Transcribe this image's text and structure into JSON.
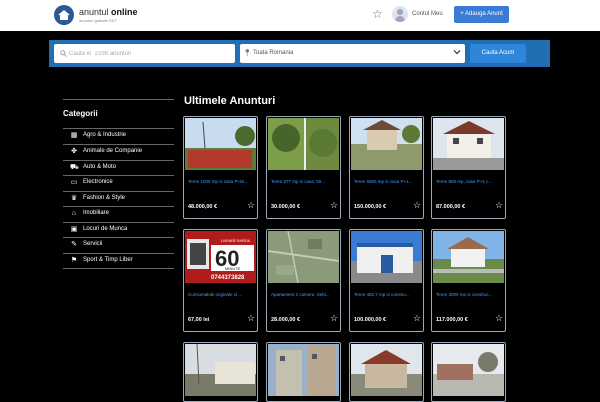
{
  "header": {
    "logo_main": "anuntul",
    "logo_bold": "online",
    "logo_sub": "anunturi gratuite 24/7",
    "account_label": "Contul Meu",
    "add_button": "+ Adauga Anunt"
  },
  "search": {
    "placeholder": "Cauta in  2298 anunturi",
    "location": "Toata Romania",
    "button": "Cauta Acum"
  },
  "sidebar": {
    "title": "Categorii",
    "items": [
      {
        "label": "Agro & Industrie",
        "icon": "grid-icon"
      },
      {
        "label": "Animale de Companie",
        "icon": "paw-icon"
      },
      {
        "label": "Auto & Moto",
        "icon": "car-icon"
      },
      {
        "label": "Electronice",
        "icon": "tv-icon"
      },
      {
        "label": "Fashion & Style",
        "icon": "shirt-icon"
      },
      {
        "label": "Imobiliare",
        "icon": "home-icon"
      },
      {
        "label": "Locuri de Munca",
        "icon": "briefcase-icon"
      },
      {
        "label": "Servicii",
        "icon": "wrench-icon"
      },
      {
        "label": "Sport & Timp Liber",
        "icon": "sport-icon"
      }
    ]
  },
  "main": {
    "title": "Ultimele Anunturi",
    "cards": [
      {
        "title": "Teren 1000 mp si casa P+M...",
        "price": "48.000,00 €"
      },
      {
        "title": "Teren 877 mp si casa, 50...",
        "price": "30.000,00 €"
      },
      {
        "title": "Teren 5000 mp si casa P+1...",
        "price": "150.000,00 €"
      },
      {
        "title": "Teren 800 mp, casa P+1 c...",
        "price": "87.000,00 €"
      },
      {
        "title": "Consumabile originale si ...",
        "price": "67,00 lei"
      },
      {
        "title": "Apartament 2 camere, Sebi...",
        "price": "28.000,00 €"
      },
      {
        "title": "Teren 462,7 mp si constru...",
        "price": "100.000,00 €"
      },
      {
        "title": "Teren 3000 mp si construc...",
        "price": "117.000,00 €"
      }
    ],
    "ad_text_top": "LIVRARE RAPIDA",
    "ad_big": "60",
    "ad_small": "MINUTE",
    "ad_phone": "0744373828"
  },
  "colors": {
    "brand_blue": "#1f6fb2",
    "button_blue": "#3a7bd5",
    "link_blue": "#3fa0ff",
    "background": "#000000"
  }
}
